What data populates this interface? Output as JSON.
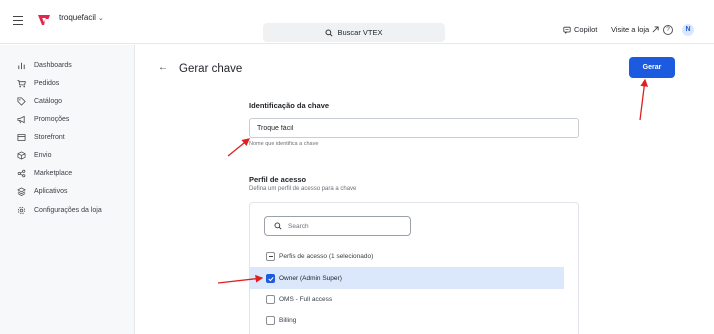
{
  "header": {
    "account_name": "troquefacil",
    "search_label": "Buscar VTEX",
    "copilot_label": "Copilot",
    "visit_store_label": "Visite a loja",
    "help_glyph": "?",
    "avatar_initial": "N",
    "brand_color": "#e2264d",
    "accent_color": "#1c5be0"
  },
  "sidebar": {
    "items": [
      {
        "label": "Dashboards",
        "icon": "chart-icon"
      },
      {
        "label": "Pedidos",
        "icon": "cart-icon"
      },
      {
        "label": "Catálogo",
        "icon": "tag-icon"
      },
      {
        "label": "Promoções",
        "icon": "megaphone-icon"
      },
      {
        "label": "Storefront",
        "icon": "storefront-icon"
      },
      {
        "label": "Envio",
        "icon": "box-icon"
      },
      {
        "label": "Marketplace",
        "icon": "network-icon"
      },
      {
        "label": "Aplicativos",
        "icon": "layers-icon"
      },
      {
        "label": "Configurações da loja",
        "icon": "gear-icon"
      }
    ]
  },
  "main": {
    "back_glyph": "←",
    "title": "Gerar chave",
    "generate_button": "Gerar",
    "identification": {
      "title": "Identificação da chave",
      "value": "Troque fácil",
      "hint": "Nome que identifica a chave"
    },
    "profile": {
      "title": "Perfil de acesso",
      "subtitle": "Defina um perfil de acesso para a chave",
      "search_placeholder": "Search",
      "group_label": "Perfis de acesso (1 selecionado)",
      "options": [
        {
          "label": "Owner (Admin Super)",
          "checked": true
        },
        {
          "label": "OMS - Full access",
          "checked": false
        },
        {
          "label": "Billing",
          "checked": false
        }
      ]
    }
  }
}
